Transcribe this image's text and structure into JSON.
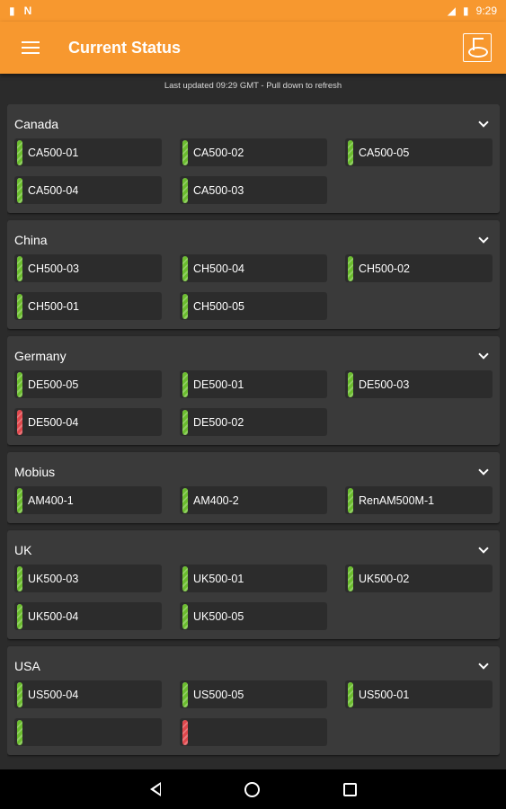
{
  "status_bar": {
    "left_icons": [
      "file-icon",
      "notification-n-icon"
    ],
    "signal": "LTE",
    "time": "9:29"
  },
  "app_bar": {
    "title": "Current Status",
    "menu_icon": "hamburger-menu-icon",
    "logo_icon": "app-logo-icon"
  },
  "updated_text": "Last updated 09:29 GMT - Pull down to refresh",
  "colors": {
    "accent": "#f7982f",
    "ok": "#6bbd2e",
    "error": "#e0474c",
    "panel": "#3a3a3a",
    "background": "#2b2b2b"
  },
  "groups": [
    {
      "name": "Canada",
      "machines": [
        {
          "name": "CA500-01",
          "status": "ok"
        },
        {
          "name": "CA500-02",
          "status": "ok"
        },
        {
          "name": "CA500-05",
          "status": "ok"
        },
        {
          "name": "CA500-04",
          "status": "ok"
        },
        {
          "name": "CA500-03",
          "status": "ok"
        }
      ]
    },
    {
      "name": "China",
      "machines": [
        {
          "name": "CH500-03",
          "status": "ok"
        },
        {
          "name": "CH500-04",
          "status": "ok"
        },
        {
          "name": "CH500-02",
          "status": "ok"
        },
        {
          "name": "CH500-01",
          "status": "ok"
        },
        {
          "name": "CH500-05",
          "status": "ok"
        }
      ]
    },
    {
      "name": "Germany",
      "machines": [
        {
          "name": "DE500-05",
          "status": "ok"
        },
        {
          "name": "DE500-01",
          "status": "ok"
        },
        {
          "name": "DE500-03",
          "status": "ok"
        },
        {
          "name": "DE500-04",
          "status": "error"
        },
        {
          "name": "DE500-02",
          "status": "ok"
        }
      ]
    },
    {
      "name": "Mobius",
      "machines": [
        {
          "name": "AM400-1",
          "status": "ok"
        },
        {
          "name": "AM400-2",
          "status": "ok"
        },
        {
          "name": "RenAM500M-1",
          "status": "ok"
        }
      ]
    },
    {
      "name": "UK",
      "machines": [
        {
          "name": "UK500-03",
          "status": "ok"
        },
        {
          "name": "UK500-01",
          "status": "ok"
        },
        {
          "name": "UK500-02",
          "status": "ok"
        },
        {
          "name": "UK500-04",
          "status": "ok"
        },
        {
          "name": "UK500-05",
          "status": "ok"
        }
      ]
    },
    {
      "name": "USA",
      "machines": [
        {
          "name": "US500-04",
          "status": "ok"
        },
        {
          "name": "US500-05",
          "status": "ok"
        },
        {
          "name": "US500-01",
          "status": "ok"
        },
        {
          "name": "",
          "status": "ok"
        },
        {
          "name": "",
          "status": "error"
        }
      ]
    }
  ],
  "nav_bar": {
    "icons": [
      "back-icon",
      "home-icon",
      "recent-apps-icon"
    ]
  }
}
